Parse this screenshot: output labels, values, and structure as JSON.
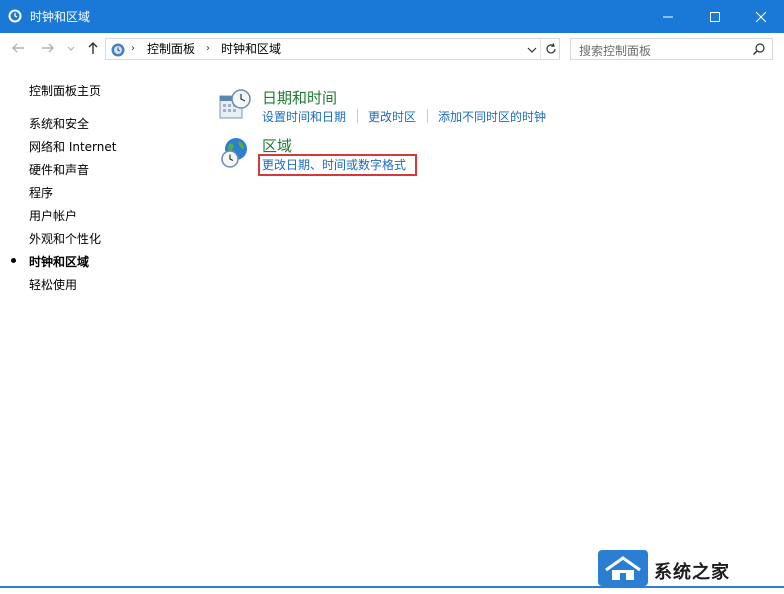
{
  "window": {
    "title": "时钟和区域"
  },
  "nav": {
    "breadcrumbs": [
      "控制面板",
      "时钟和区域"
    ],
    "search_placeholder": "搜索控制面板"
  },
  "left_pane": {
    "home": "控制面板主页",
    "items": [
      "系统和安全",
      "网络和 Internet",
      "硬件和声音",
      "程序",
      "用户帐户",
      "外观和个性化",
      "时钟和区域",
      "轻松使用"
    ],
    "current": "时钟和区域"
  },
  "categories": [
    {
      "title": "日期和时间",
      "icon": "clock-calendar-icon",
      "links": [
        "设置时间和日期",
        "更改时区",
        "添加不同时区的时钟"
      ]
    },
    {
      "title": "区域",
      "icon": "globe-clock-icon",
      "links": [
        "更改日期、时间或数字格式"
      ]
    }
  ],
  "watermark": {
    "text": "系统之家"
  },
  "colors": {
    "titlebar": "#1a78d6",
    "category_title": "#1e7b33",
    "link": "#1c6bbf",
    "highlight_box": "#d33a3a"
  }
}
